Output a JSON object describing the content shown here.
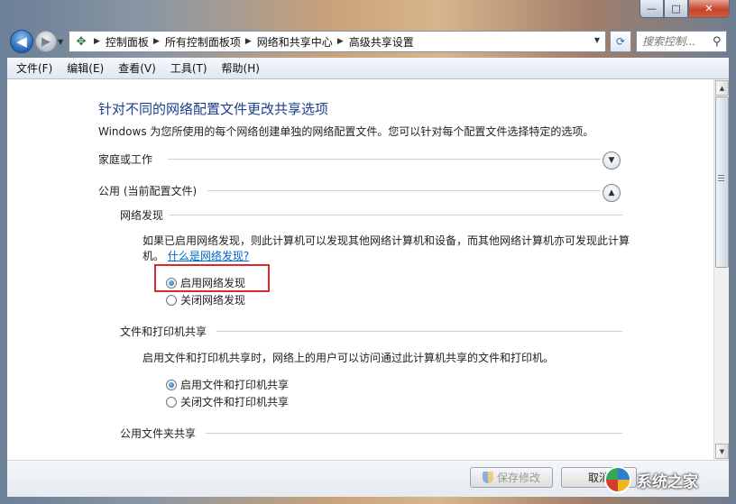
{
  "caption": {
    "min_glyph": "—",
    "max_glyph": "□",
    "close_glyph": "✕"
  },
  "nav": {
    "back_glyph": "◀",
    "forward_glyph": "▶",
    "breadcrumbs": [
      "控制面板",
      "所有控制面板项",
      "网络和共享中心",
      "高级共享设置"
    ],
    "search_placeholder": "搜索控制..."
  },
  "menu": [
    "文件(F)",
    "编辑(E)",
    "查看(V)",
    "工具(T)",
    "帮助(H)"
  ],
  "page": {
    "title": "针对不同的网络配置文件更改共享选项",
    "description": "Windows 为您所使用的每个网络创建单独的网络配置文件。您可以针对每个配置文件选择特定的选项。"
  },
  "profiles": [
    {
      "label": "家庭或工作",
      "expanded": false
    },
    {
      "label": "公用 (当前配置文件)",
      "expanded": true
    }
  ],
  "network_discovery": {
    "heading": "网络发现",
    "text": "如果已启用网络发现，则此计算机可以发现其他网络计算机和设备，而其他网络计算机亦可发现此计算机。",
    "link": "什么是网络发现?",
    "options": [
      {
        "label": "启用网络发现",
        "selected": true
      },
      {
        "label": "关闭网络发现",
        "selected": false
      }
    ]
  },
  "file_printer_sharing": {
    "heading": "文件和打印机共享",
    "text": "启用文件和打印机共享时，网络上的用户可以访问通过此计算机共享的文件和打印机。",
    "options": [
      {
        "label": "启用文件和打印机共享",
        "selected": true
      },
      {
        "label": "关闭文件和打印机共享",
        "selected": false
      }
    ]
  },
  "public_folder_sharing": {
    "heading": "公用文件夹共享"
  },
  "buttons": {
    "save": "保存修改",
    "cancel": "取消"
  },
  "watermark": {
    "text": "系统之家"
  }
}
